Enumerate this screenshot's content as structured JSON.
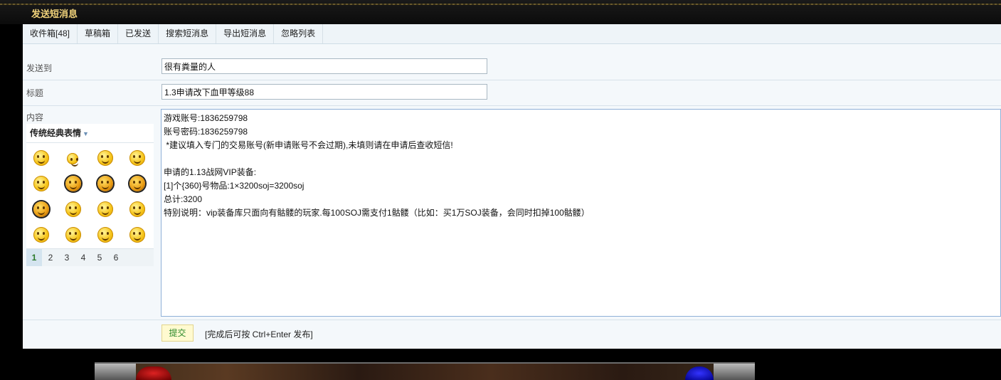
{
  "window": {
    "title": "发送短消息"
  },
  "tabs": [
    {
      "label": "收件箱[48]"
    },
    {
      "label": "草稿箱"
    },
    {
      "label": "已发送"
    },
    {
      "label": "搜索短消息"
    },
    {
      "label": "导出短消息"
    },
    {
      "label": "忽略列表"
    }
  ],
  "form": {
    "to_label": "发送到",
    "to_value": "很有粪量的人",
    "subject_label": "标题",
    "subject_value": "1.3申请改下血甲等级88",
    "content_label": "内容",
    "content_value": "游戏账号:1836259798\n账号密码:1836259798\n *建议填入专门的交易账号(新申请账号不会过期),未填则请在申请后查收短信!\n\n申请的1.13战网VIP装备:\n[1]个{360}号物品:1×3200soj=3200soj\n总计:3200\n特别说明：vip装备库只面向有骷髅的玩家.每100SOJ需支付1骷髅（比如：买1万SOJ装备，会同时扣掉100骷髅）"
  },
  "smilies": {
    "title": "传统经典表情",
    "pages": [
      "1",
      "2",
      "3",
      "4",
      "5",
      "6"
    ],
    "active_page": "1"
  },
  "actions": {
    "submit_label": "提交",
    "hint": "[完成后可按 Ctrl+Enter 发布]"
  }
}
